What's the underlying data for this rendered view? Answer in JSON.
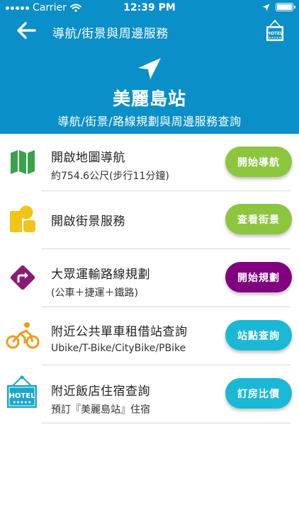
{
  "status_bar": {
    "carrier": "Carrier",
    "time": "12:39 PM"
  },
  "nav": {
    "title": "導航/街景與周邊服務",
    "hotel_icon_text": "HOTEL"
  },
  "hero": {
    "station_name": "美麗島站",
    "subtitle": "導航/街景/路線規劃與周邊服務查詢"
  },
  "colors": {
    "header": "#0a8fc8",
    "green": "#8cc63e",
    "purple": "#800080",
    "cyan": "#1bb8d6",
    "map_icon": "#3aa24a",
    "streetview_icon": "#f2c418",
    "route_icon": "#8b1a74",
    "bike_icon": "#f39a1b",
    "hotel_icon": "#1aa7c9"
  },
  "items": [
    {
      "icon": "map-icon",
      "title": "開啟地圖導航",
      "subtitle": "約754.6公尺(步行11分鐘)",
      "button": "開始導航"
    },
    {
      "icon": "street-view-icon",
      "title": "開啟街景服務",
      "subtitle": "",
      "button": "查看街景"
    },
    {
      "icon": "route-sign-icon",
      "title": "大眾運輸路線規劃",
      "subtitle": "(公車＋捷運＋鐵路)",
      "button": "開始規劃"
    },
    {
      "icon": "bicycle-icon",
      "title": "附近公共單車租借站查詢",
      "subtitle": "Ubike/T-Bike/CityBike/PBike",
      "button": "站點查詢"
    },
    {
      "icon": "hotel-icon",
      "title": "附近飯店住宿查詢",
      "subtitle": "預訂『美麗島站』住宿",
      "button": "訂房比價"
    }
  ]
}
